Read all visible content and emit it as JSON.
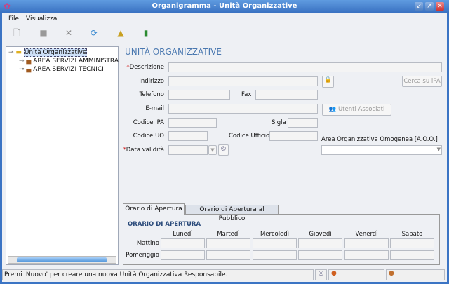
{
  "window": {
    "title": "Organigramma - Unità Organizzative"
  },
  "menu": [
    "File",
    "Visualizza"
  ],
  "tree": {
    "root": "Unità Organizzative",
    "children": [
      "AREA SERVIZI AMMINISTRA",
      "AREA SERVIZI TECNICI"
    ]
  },
  "form": {
    "heading": "UNITÀ ORGANIZZATIVE",
    "required_mark": "*",
    "descrizione": "Descrizione",
    "indirizzo": "Indirizzo",
    "cerca": "Cerca su iPA",
    "telefono": "Telefono",
    "fax": "Fax",
    "email": "E-mail",
    "utenti": "Utenti Associati",
    "codice_ipa": "Codice iPA",
    "sigla": "Sigla",
    "codice_uo": "Codice UO",
    "codice_ufficio": "Codice Ufficio",
    "aoo": "Area Organizzativa Omogenea [A.O.O.]",
    "data_validita": "Data validità"
  },
  "tabs": [
    "Orario di Apertura",
    "Orario di Apertura al Pubblico"
  ],
  "orario": {
    "heading": "ORARIO DI APERTURA",
    "days": [
      "Lunedì",
      "Martedì",
      "Mercoledì",
      "Giovedì",
      "Venerdì",
      "Sabato"
    ],
    "rows": [
      "Mattino",
      "Pomeriggio"
    ]
  },
  "status": "Premi 'Nuovo' per creare una nuova Unità Organizzativa Responsabile."
}
